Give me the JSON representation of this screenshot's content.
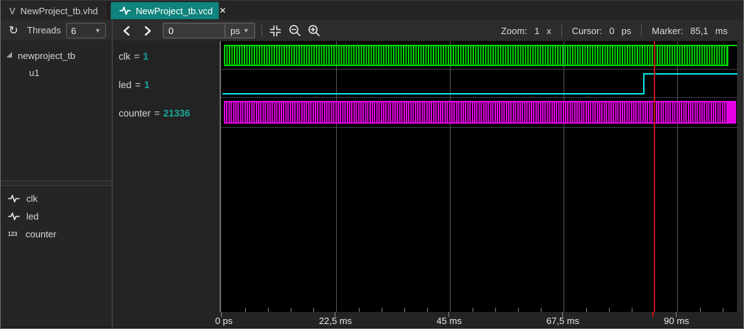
{
  "tabs": {
    "vhd": {
      "icon_letter": "V",
      "label": "NewProject_tb.vhd"
    },
    "vcd": {
      "label": "NewProject_tb.vcd",
      "close_glyph": "✕"
    }
  },
  "toolbar": {
    "refresh_glyph": "↻",
    "threads": {
      "label": "Threads",
      "value": "6"
    },
    "time_input": {
      "value": "0",
      "unit": "ps"
    },
    "status": {
      "zoom_label": "Zoom:",
      "zoom_value": "1",
      "zoom_unit": "x",
      "cursor_label": "Cursor:",
      "cursor_value": "0",
      "cursor_unit": "ps",
      "marker_label": "Marker:",
      "marker_value": "85,1",
      "marker_unit": "ms"
    }
  },
  "sidebar": {
    "tree": [
      {
        "label": "newproject_tb"
      },
      {
        "label": "u1"
      }
    ],
    "signals": [
      {
        "label": "clk",
        "icon": "waveform-icon"
      },
      {
        "label": "led",
        "icon": "waveform-icon"
      },
      {
        "label": "counter",
        "icon": "number-icon"
      }
    ]
  },
  "wave": {
    "rows": [
      {
        "name": "clk",
        "sep": "=",
        "value": "1",
        "kind": "clock"
      },
      {
        "name": "led",
        "sep": "=",
        "value": "1",
        "kind": "bit",
        "rise_time_estimate": "≈83,5 ms"
      },
      {
        "name": "counter",
        "sep": "=",
        "value": "21336",
        "kind": "bus"
      }
    ],
    "marker_time": "85,1 ms"
  },
  "axis": {
    "ticks": [
      "0 ps",
      "22,5 ms",
      "45 ms",
      "67,5 ms",
      "90 ms"
    ]
  },
  "colors": {
    "active_tab": "#0f837c",
    "clk": "#00d600",
    "led": "#00e6e6",
    "counter": "#e600e6",
    "marker": "#bf1414",
    "value_text": "#18a999"
  }
}
